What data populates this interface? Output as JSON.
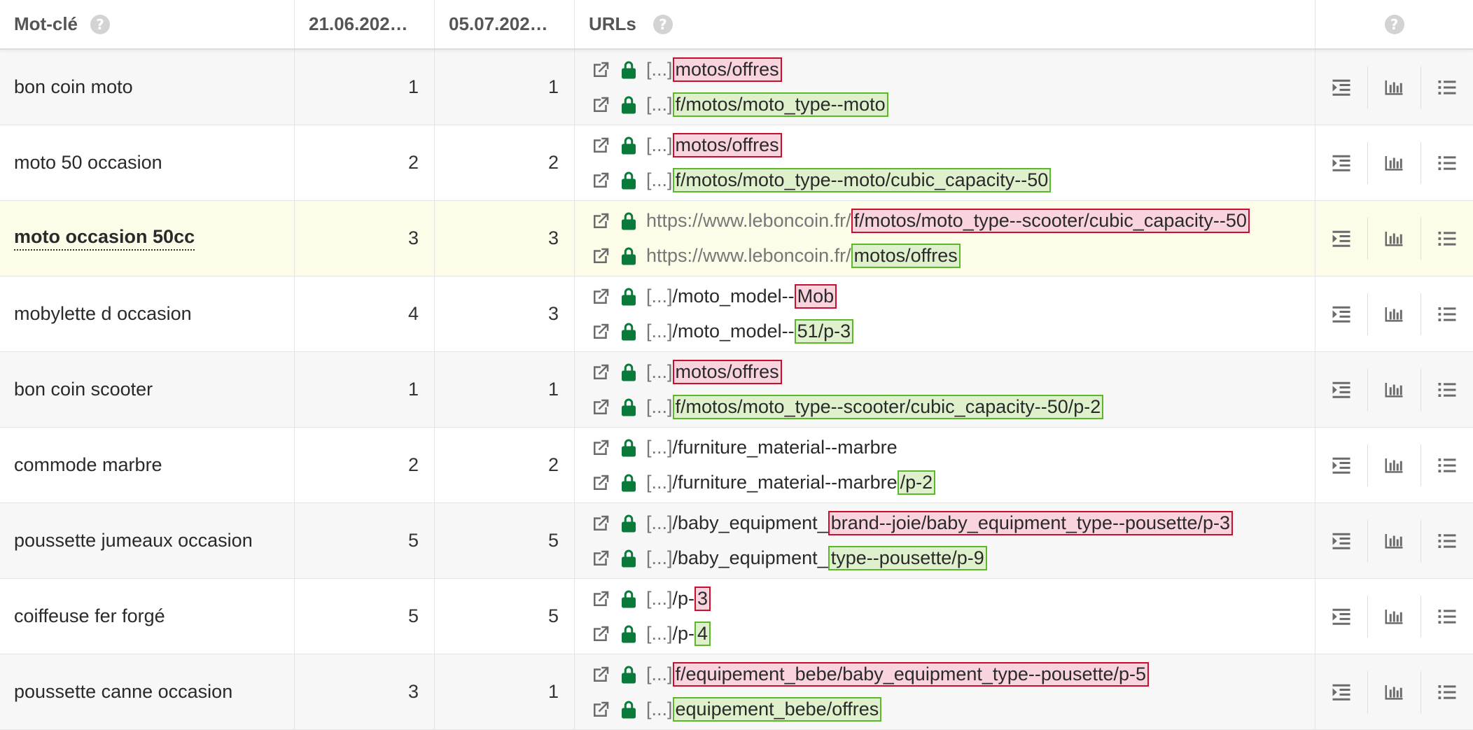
{
  "header": {
    "keyword_label": "Mot-clé",
    "date1_label": "21.06.202…",
    "date2_label": "05.07.202…",
    "urls_label": "URLs",
    "help_glyph": "?"
  },
  "colors": {
    "diff_removed_border": "#c8102e",
    "diff_removed_bg": "#f9d3dd",
    "diff_added_border": "#5cb82a",
    "diff_added_bg": "#dff1cc",
    "lock_green": "#0a7a3b",
    "highlight_row": "#fcfce9"
  },
  "rows": [
    {
      "keyword": "bon coin moto",
      "rank1": "1",
      "rank2": "1",
      "url1": {
        "prefix": "[...]",
        "plain": "",
        "diff": "motos/offres"
      },
      "url2": {
        "prefix": "[...]",
        "plain": "",
        "diff": "f/motos/moto_type--moto"
      }
    },
    {
      "keyword": "moto 50 occasion",
      "rank1": "2",
      "rank2": "2",
      "url1": {
        "prefix": "[...]",
        "plain": "",
        "diff": "motos/offres"
      },
      "url2": {
        "prefix": "[...]",
        "plain": "",
        "diff": "f/motos/moto_type--moto/cubic_capacity--50"
      }
    },
    {
      "keyword": "moto occasion 50cc",
      "rank1": "3",
      "rank2": "3",
      "url1": {
        "prefix": "https://www.leboncoin.fr/",
        "plain": "",
        "diff": "f/motos/moto_type--scooter/cubic_capacity--50"
      },
      "url2": {
        "prefix": "https://www.leboncoin.fr/",
        "plain": "",
        "diff": "motos/offres"
      }
    },
    {
      "keyword": "mobylette d occasion",
      "rank1": "4",
      "rank2": "3",
      "url1": {
        "prefix": "[...]",
        "plain": "/moto_model--",
        "diff": "Mob"
      },
      "url2": {
        "prefix": "[...]",
        "plain": "/moto_model--",
        "diff": "51/p-3"
      }
    },
    {
      "keyword": "bon coin scooter",
      "rank1": "1",
      "rank2": "1",
      "url1": {
        "prefix": "[...]",
        "plain": "",
        "diff": "motos/offres"
      },
      "url2": {
        "prefix": "[...]",
        "plain": "",
        "diff": "f/motos/moto_type--scooter/cubic_capacity--50/p-2"
      }
    },
    {
      "keyword": "commode marbre",
      "rank1": "2",
      "rank2": "2",
      "url1": {
        "prefix": "[...]",
        "plain": "/furniture_material--marbre",
        "diff": ""
      },
      "url2": {
        "prefix": "[...]",
        "plain": "/furniture_material--marbre",
        "diff": "/p-2"
      }
    },
    {
      "keyword": "poussette jumeaux occasion",
      "rank1": "5",
      "rank2": "5",
      "url1": {
        "prefix": "[...]",
        "plain": "/baby_equipment_",
        "diff": "brand--joie/baby_equipment_type--pousette/p-3"
      },
      "url2": {
        "prefix": "[...]",
        "plain": "/baby_equipment_",
        "diff": "type--pousette/p-9"
      }
    },
    {
      "keyword": "coiffeuse fer forgé",
      "rank1": "5",
      "rank2": "5",
      "url1": {
        "prefix": "[...]",
        "plain": "/p-",
        "diff": "3"
      },
      "url2": {
        "prefix": "[...]",
        "plain": "/p-",
        "diff": "4"
      }
    },
    {
      "keyword": "poussette canne occasion",
      "rank1": "3",
      "rank2": "1",
      "url1": {
        "prefix": "[...]",
        "plain": "",
        "diff": "f/equipement_bebe/baby_equipment_type--pousette/p-5"
      },
      "url2": {
        "prefix": "[...]",
        "plain": "",
        "diff": "equipement_bebe/offres"
      }
    }
  ],
  "icons": {
    "external_link": "external-link-icon",
    "lock": "lock-icon",
    "indent": "indent-icon",
    "bar_chart": "bar-chart-icon",
    "list": "list-icon",
    "help": "help-icon"
  }
}
